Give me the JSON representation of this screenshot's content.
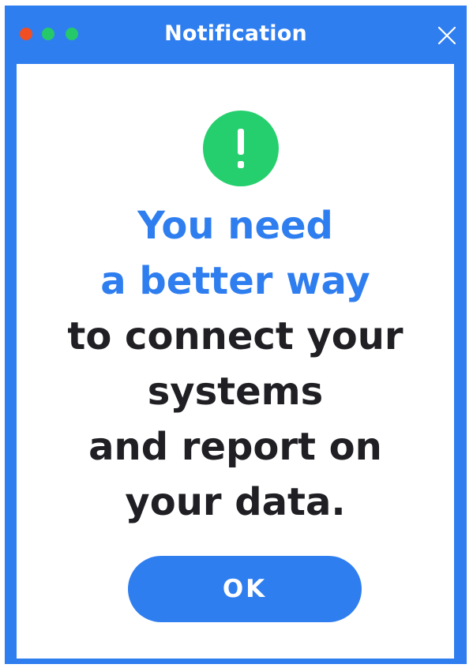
{
  "window": {
    "title": "Notification",
    "frame_color": "#2f7ef0",
    "traffic_lights": [
      "#f04f23",
      "#25c96a",
      "#25c96a"
    ],
    "close_icon": "close-icon"
  },
  "alert": {
    "icon": "exclamation-icon",
    "icon_color": "#26cf6d"
  },
  "message": {
    "highlight_color": "#2f7ef0",
    "text_color": "#1f1f24",
    "lines": [
      "You need",
      "a better way",
      "to connect your",
      "systems",
      "and report on",
      "your data."
    ]
  },
  "button": {
    "label": "OK",
    "color": "#2f7ef0"
  }
}
